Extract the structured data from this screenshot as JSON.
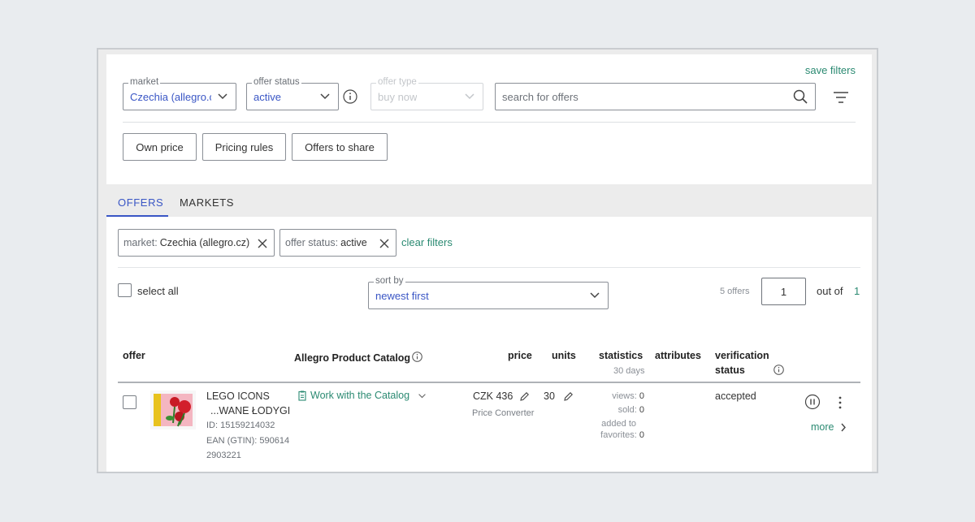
{
  "filters": {
    "save_filters": "save filters",
    "market": {
      "label": "market",
      "value": "Czechia (allegro.c"
    },
    "offer_status": {
      "label": "offer status",
      "value": "active"
    },
    "offer_type": {
      "label": "offer type",
      "value": "buy now"
    },
    "search": {
      "placeholder": "search for offers"
    }
  },
  "buttons": {
    "own_price": "Own price",
    "pricing_rules": "Pricing rules",
    "offers_to_share": "Offers to share"
  },
  "tabs": [
    {
      "label": "OFFERS",
      "active": true
    },
    {
      "label": "MARKETS",
      "active": false
    }
  ],
  "active_filters": {
    "chips": [
      {
        "key": "market:",
        "value": "Czechia (allegro.cz)"
      },
      {
        "key": "offer status:",
        "value": "active"
      }
    ],
    "clear": "clear filters"
  },
  "list_controls": {
    "select_all": "select all",
    "sort": {
      "label": "sort by",
      "value": "newest first"
    },
    "offers_count": "5 offers",
    "page": "1",
    "out_of": "out of",
    "total_pages": "1"
  },
  "table": {
    "headers": {
      "offer": "offer",
      "catalog": "Allegro Product Catalog",
      "price": "price",
      "units": "units",
      "statistics": "statistics",
      "statistics_sub": "30 days",
      "attributes": "attributes",
      "verification_l1": "verification",
      "verification_l2": "status"
    },
    "rows": [
      {
        "name_l1": "LEGO ICONS",
        "name_l2": "...WANE ŁODYGI",
        "id": "ID: 15159214032",
        "ean_l1": "EAN (GTIN): 590614",
        "ean_l2": "2903221",
        "catalog_action": "Work with the Catalog",
        "price": "CZK 436",
        "price_sub": "Price Converter",
        "units": "30",
        "views_label": "views:",
        "views": "0",
        "sold_label": "sold:",
        "sold": "0",
        "fav_label_l1": "added to",
        "fav_label_l2": "favorites:",
        "favorites": "0",
        "verification": "accepted",
        "more": "more"
      }
    ]
  },
  "colors": {
    "accent_blue": "#3a56c5",
    "accent_green": "#2b8a72"
  },
  "icons": [
    "chevron-down-icon",
    "info-icon",
    "search-icon",
    "filter-icon",
    "close-icon",
    "catalog-icon",
    "pencil-icon",
    "pause-icon",
    "kebab-icon",
    "chevron-right-icon"
  ]
}
